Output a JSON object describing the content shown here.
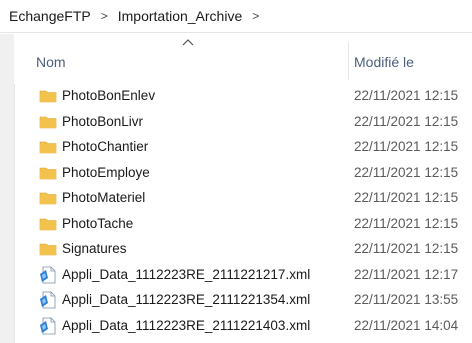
{
  "breadcrumb": {
    "items": [
      "EchangeFTP",
      "Importation_Archive"
    ],
    "separator": ">"
  },
  "columns": {
    "name": "Nom",
    "modified": "Modifié le"
  },
  "colors": {
    "folder": "#f3c24d",
    "header_text": "#4c607a",
    "date_text": "#5b5b5b"
  },
  "files": [
    {
      "name": "PhotoBonEnlev",
      "modified": "22/11/2021 12:15",
      "type": "folder"
    },
    {
      "name": "PhotoBonLivr",
      "modified": "22/11/2021 12:15",
      "type": "folder"
    },
    {
      "name": "PhotoChantier",
      "modified": "22/11/2021 12:15",
      "type": "folder"
    },
    {
      "name": "PhotoEmploye",
      "modified": "22/11/2021 12:15",
      "type": "folder"
    },
    {
      "name": "PhotoMateriel",
      "modified": "22/11/2021 12:15",
      "type": "folder"
    },
    {
      "name": "PhotoTache",
      "modified": "22/11/2021 12:15",
      "type": "folder"
    },
    {
      "name": "Signatures",
      "modified": "22/11/2021 12:15",
      "type": "folder"
    },
    {
      "name": "Appli_Data_1112223RE_2111221217.xml",
      "modified": "22/11/2021 12:17",
      "type": "xml"
    },
    {
      "name": "Appli_Data_1112223RE_2111221354.xml",
      "modified": "22/11/2021 13:55",
      "type": "xml"
    },
    {
      "name": "Appli_Data_1112223RE_2111221403.xml",
      "modified": "22/11/2021 14:04",
      "type": "xml"
    }
  ]
}
